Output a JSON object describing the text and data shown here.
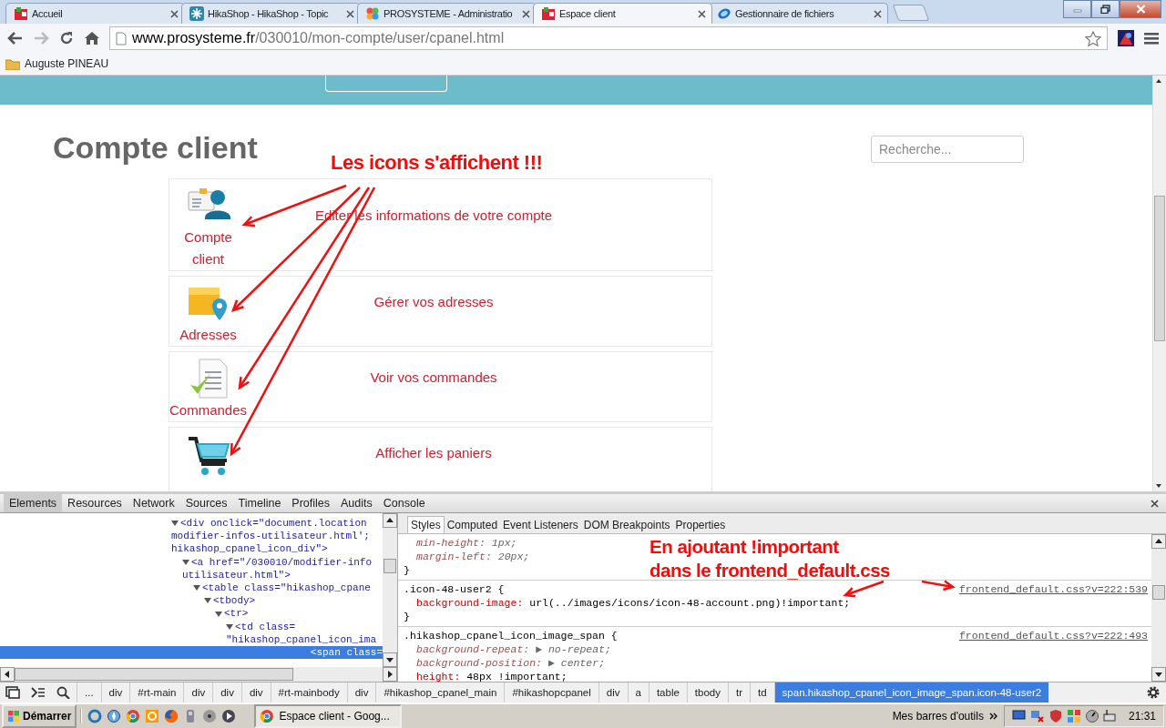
{
  "browser": {
    "tabs": [
      {
        "title": "Accueil",
        "kind": "box",
        "selected": false
      },
      {
        "title": "HikaShop - HikaShop - Topic",
        "kind": "snowflake",
        "selected": false
      },
      {
        "title": "PROSYSTEME - Administratio",
        "kind": "flower",
        "selected": false
      },
      {
        "title": "Espace client",
        "kind": "box",
        "selected": true
      },
      {
        "title": "Gestionnaire de fichiers",
        "kind": "swirl",
        "selected": false
      }
    ],
    "url": {
      "host": "www.prosysteme.fr",
      "path": "/030010/mon-compte/user/cpanel.html"
    },
    "bookmarks": [
      "Auguste PINEAU"
    ]
  },
  "page": {
    "title": "Compte client",
    "search": {
      "placeholder": "Recherche..."
    },
    "annotation": "Les icons s'affichent !!!",
    "items": [
      {
        "kind": "account",
        "label": "Compte client",
        "description": "Editer les informations de votre compte"
      },
      {
        "kind": "address",
        "label": "Adresses",
        "description": "Gérer vos adresses"
      },
      {
        "kind": "orders",
        "label": "Commandes",
        "description": "Voir vos commandes"
      },
      {
        "kind": "cart",
        "description": "Afficher les paniers"
      }
    ]
  },
  "devtools": {
    "tabs": [
      {
        "label": "Elements",
        "selected": true
      },
      {
        "label": "Resources",
        "selected": false
      },
      {
        "label": "Network",
        "selected": false
      },
      {
        "label": "Sources",
        "selected": false
      },
      {
        "label": "Timeline",
        "selected": false
      },
      {
        "label": "Profiles",
        "selected": false
      },
      {
        "label": "Audits",
        "selected": false
      },
      {
        "label": "Console",
        "selected": false
      }
    ],
    "dom": [
      {
        "lines": [
          "<div onclick=\"document.location",
          "modifier-infos-utilisateur.html';",
          "hikashop_cpanel_icon_div\">"
        ],
        "expanded": true,
        "selected": false,
        "children": [
          {
            "lines": [
              "<a href=\"/030010/modifier-info",
              "utilisateur.html\">"
            ],
            "expanded": true,
            "selected": false,
            "children": [
              {
                "lines": [
                  "<table class=\"hikashop_cpane"
                ],
                "expanded": true,
                "selected": false,
                "children": [
                  {
                    "lines": [
                      "<tbody>"
                    ],
                    "expanded": true,
                    "selected": false,
                    "children": [
                      {
                        "lines": [
                          "<tr>"
                        ],
                        "expanded": true,
                        "selected": false,
                        "children": [
                          {
                            "lines": [
                              "<td class=",
                              "\"hikashop_cpanel_icon_ima"
                            ],
                            "expanded": true,
                            "selected": false,
                            "children": [
                              {
                                "lines": [
                                  "<span class="
                                ],
                                "selected": true
                              }
                            ]
                          }
                        ]
                      }
                    ]
                  }
                ]
              }
            ]
          }
        ]
      }
    ],
    "style_tabs": [
      {
        "label": "Styles",
        "selected": true
      },
      {
        "label": "Computed",
        "selected": false
      },
      {
        "label": "Event Listeners",
        "selected": false
      },
      {
        "label": "DOM Breakpoints",
        "selected": false
      },
      {
        "label": "Properties",
        "selected": false
      }
    ],
    "rules": [
      {
        "declarations": [
          {
            "property": "min-height:",
            "value": "1px;",
            "struck": true
          },
          {
            "property": "margin-left:",
            "value": "20px;",
            "struck": true
          }
        ],
        "closing": "}"
      },
      {
        "selector": ".icon-48-user2 {",
        "source": "frontend_default.css?v=222:539",
        "declarations": [
          {
            "property": "background-image:",
            "value": "url(../images/icons/icon-48-account.png)!important;",
            "struck": false
          }
        ],
        "closing": "}"
      },
      {
        "selector": ".hikashop_cpanel_icon_image_span {",
        "source": "frontend_default.css?v=222:493",
        "declarations": [
          {
            "property": "background-repeat:",
            "value": "▶ no-repeat;",
            "struck": true
          },
          {
            "property": "background-position:",
            "value": "▶ center;",
            "struck": true
          },
          {
            "property": "height:",
            "value": "48px !important;",
            "struck": false
          }
        ]
      }
    ],
    "annotation": [
      "En ajoutant !important",
      "dans le frontend_default.css"
    ],
    "breadcrumbs": [
      {
        "label": "...",
        "selected": false
      },
      {
        "label": "div",
        "selected": false
      },
      {
        "label": "#rt-main",
        "selected": false
      },
      {
        "label": "div",
        "selected": false
      },
      {
        "label": "div",
        "selected": false
      },
      {
        "label": "div",
        "selected": false
      },
      {
        "label": "#rt-mainbody",
        "selected": false
      },
      {
        "label": "div",
        "selected": false
      },
      {
        "label": "#hikashop_cpanel_main",
        "selected": false
      },
      {
        "label": "#hikashopcpanel",
        "selected": false
      },
      {
        "label": "div",
        "selected": false
      },
      {
        "label": "a",
        "selected": false
      },
      {
        "label": "table",
        "selected": false
      },
      {
        "label": "tbody",
        "selected": false
      },
      {
        "label": "tr",
        "selected": false
      },
      {
        "label": "td",
        "selected": false
      },
      {
        "label": "span.hikashop_cpanel_icon_image_span.icon-48-user2",
        "selected": true
      }
    ]
  },
  "taskbar": {
    "start": "Démarrer",
    "window": "Espace client - Goog...",
    "toolbars": "Mes barres d'outils",
    "time": "21:31"
  }
}
